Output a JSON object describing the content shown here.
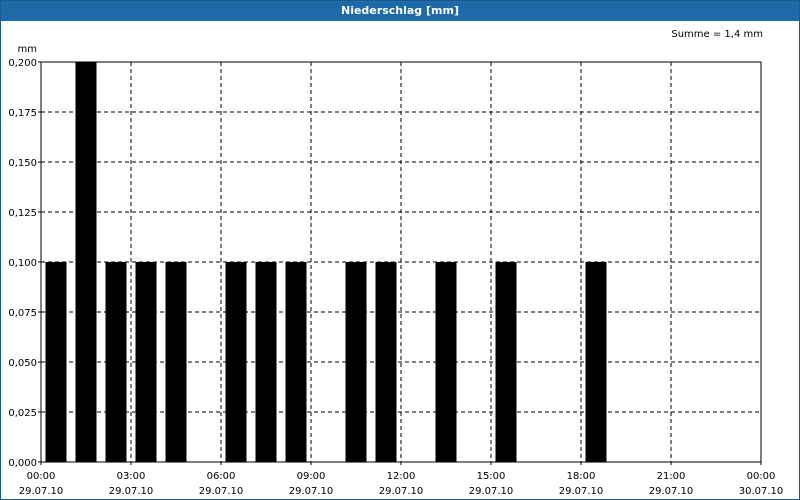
{
  "window": {
    "title": "Niederschlag [mm]"
  },
  "chart_data": {
    "type": "bar",
    "title": "Niederschlag [mm]",
    "ylabel": "mm",
    "annotation": "Summe = 1,4 mm",
    "ylim": [
      0,
      0.2
    ],
    "yticks": [
      "0,000",
      "0,025",
      "0,050",
      "0,075",
      "0,100",
      "0,125",
      "0,150",
      "0,175",
      "0,200"
    ],
    "xlim_hours": [
      0,
      24
    ],
    "xticks": [
      {
        "time": "00:00",
        "date": "29.07.10"
      },
      {
        "time": "03:00",
        "date": "29.07.10"
      },
      {
        "time": "06:00",
        "date": "29.07.10"
      },
      {
        "time": "09:00",
        "date": "29.07.10"
      },
      {
        "time": "12:00",
        "date": "29.07.10"
      },
      {
        "time": "15:00",
        "date": "29.07.10"
      },
      {
        "time": "18:00",
        "date": "29.07.10"
      },
      {
        "time": "21:00",
        "date": "29.07.10"
      },
      {
        "time": "00:00",
        "date": "30.07.10"
      }
    ],
    "grid": true,
    "bar_color": "#000000",
    "categories": [
      "00:00",
      "01:00",
      "02:00",
      "03:00",
      "04:00",
      "05:00",
      "06:00",
      "07:00",
      "08:00",
      "09:00",
      "10:00",
      "11:00",
      "12:00",
      "13:00",
      "14:00",
      "15:00",
      "16:00",
      "17:00",
      "18:00",
      "19:00",
      "20:00",
      "21:00",
      "22:00",
      "23:00"
    ],
    "values": [
      0.1,
      0.2,
      0.1,
      0.1,
      0.1,
      0,
      0.1,
      0.1,
      0.1,
      0,
      0.1,
      0.1,
      0,
      0.1,
      0,
      0.1,
      0,
      0,
      0.1,
      0,
      0,
      0,
      0,
      0
    ]
  }
}
